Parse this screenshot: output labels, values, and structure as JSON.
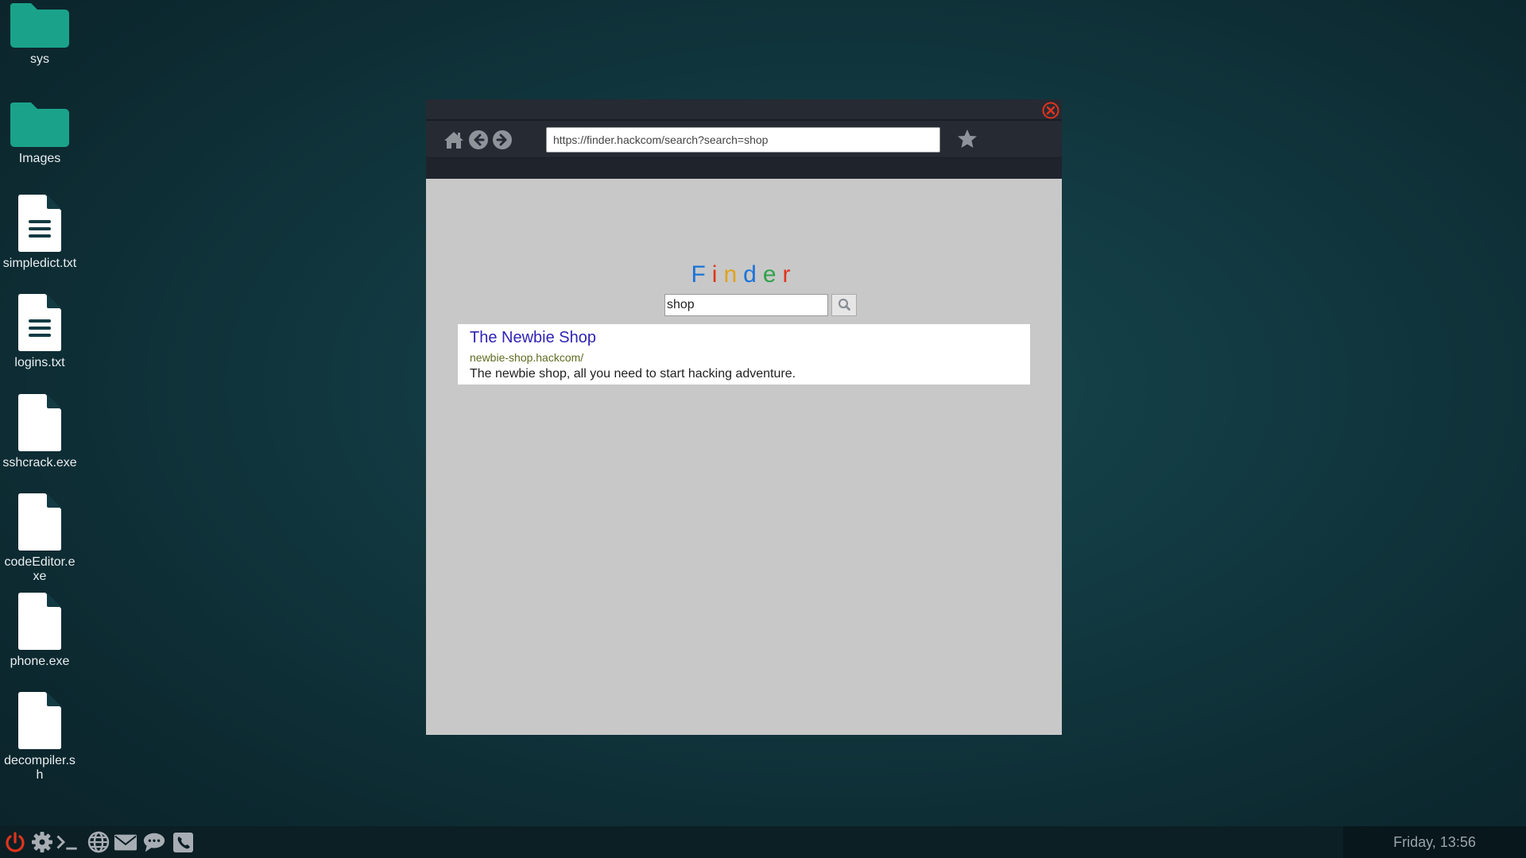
{
  "desktop": {
    "icons": [
      {
        "label": "sys",
        "type": "folder"
      },
      {
        "label": "Images",
        "type": "folder"
      },
      {
        "label": "simpledict.txt",
        "type": "text-file"
      },
      {
        "label": "logins.txt",
        "type": "text-file"
      },
      {
        "label": "sshcrack.exe",
        "type": "file"
      },
      {
        "label": "codeEditor.exe",
        "type": "file"
      },
      {
        "label": "phone.exe",
        "type": "file"
      },
      {
        "label": "decompiler.sh",
        "type": "file"
      }
    ]
  },
  "browser": {
    "url": "https://finder.hackcom/search?search=shop",
    "nav_icons": [
      "home-icon",
      "back-icon",
      "forward-icon",
      "bookmark-star-icon"
    ],
    "close_icon": "close-icon"
  },
  "finder": {
    "logo_letters": [
      {
        "char": "F",
        "color": "#1a73d9"
      },
      {
        "char": "i",
        "color": "#e0341c"
      },
      {
        "char": "n",
        "color": "#e0a21c"
      },
      {
        "char": "d",
        "color": "#1a73d9"
      },
      {
        "char": "e",
        "color": "#2ea34a"
      },
      {
        "char": "r",
        "color": "#e0341c"
      }
    ],
    "search_value": "shop",
    "results": [
      {
        "title": "The Newbie Shop",
        "url": "newbie-shop.hackcom/",
        "description": "The newbie shop, all you need to start hacking adventure."
      }
    ]
  },
  "taskbar": {
    "icons": [
      "power-icon",
      "settings-icon",
      "terminal-icon",
      "browser-globe-icon",
      "mail-icon",
      "chat-icon",
      "phone-icon"
    ],
    "clock": "Friday, 13:56"
  },
  "colors": {
    "power": "#e0341c",
    "close": "#e0341c",
    "folder": "#1aa38a",
    "link": "#2f24b4",
    "url_green": "#5d6b1f"
  }
}
